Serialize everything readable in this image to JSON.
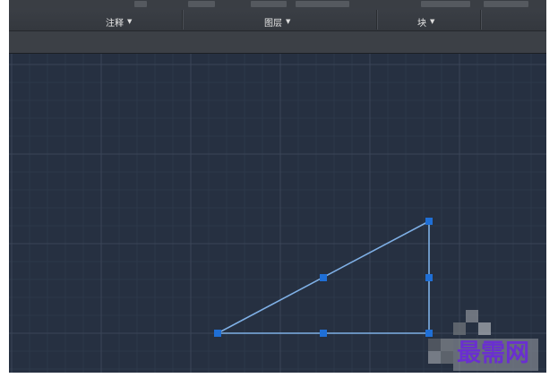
{
  "ribbon": {
    "panels": [
      {
        "label": "注释"
      },
      {
        "label": "图层"
      },
      {
        "label": "块"
      }
    ]
  },
  "drawing": {
    "watermark": "最需网",
    "colors": {
      "canvas_bg": "#263041",
      "grid_minor": "#2f3a4c",
      "grid_major": "#3a4558",
      "line": "#7fb0e6",
      "grip": "#1f6fd6"
    },
    "icons": [
      "chevron-down-icon",
      "grip-icon"
    ]
  }
}
